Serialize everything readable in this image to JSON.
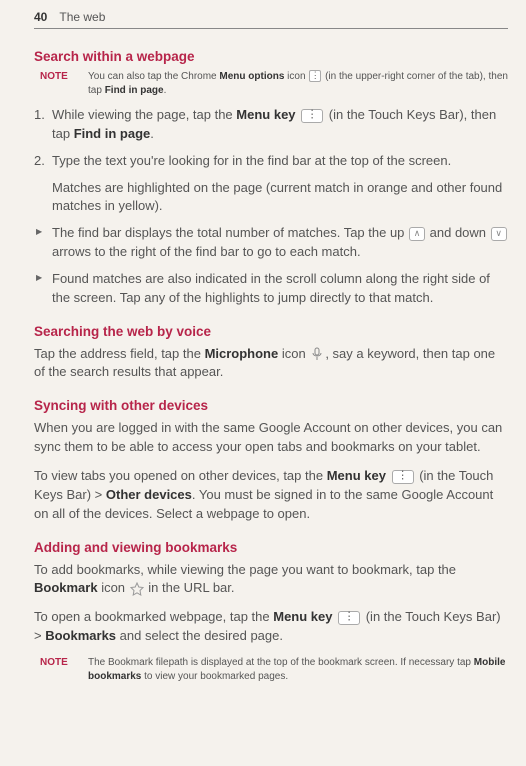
{
  "page_number": "40",
  "header_title": "The web",
  "sections": {
    "search_within": {
      "heading": "Search within a webpage",
      "note_label": "NOTE",
      "note_pre": "You can also tap the Chrome ",
      "note_bold1": "Menu options",
      "note_mid": " icon ",
      "note_post": " (in the upper-right corner of the tab), then tap ",
      "note_bold2": "Find in page",
      "note_end": ".",
      "step1_a": "While viewing the page, tap the ",
      "step1_bold": "Menu key",
      "step1_b": " (in the Touch Keys Bar), then tap ",
      "step1_bold2": "Find in page",
      "step1_c": ".",
      "step2": "Type the text you're looking for in the find bar at the top of the screen.",
      "step2_sub": "Matches are highlighted on the page (current match in orange and other found matches in yellow).",
      "bullet1_a": "The find bar displays the total number of matches. Tap the up ",
      "bullet1_b": " and down ",
      "bullet1_c": " arrows to the right of the find bar to go to each match.",
      "bullet2": "Found matches are also indicated in the scroll column along the right side of the screen. Tap any of the highlights to jump directly to that match."
    },
    "voice": {
      "heading": "Searching the web by voice",
      "text_a": "Tap the address field, tap the ",
      "text_bold": "Microphone",
      "text_b": " icon ",
      "text_c": ", say a keyword, then tap one of the search results that appear."
    },
    "syncing": {
      "heading": "Syncing with other devices",
      "p1": "When you are logged in with the same Google Account on other devices, you can sync them to be able to access your open tabs and bookmarks on your tablet.",
      "p2_a": "To view tabs you opened on other devices, tap the ",
      "p2_bold1": "Menu key",
      "p2_b": " (in the Touch Keys Bar) > ",
      "p2_bold2": "Other devices",
      "p2_c": ". You must be signed in to the same Google Account on all of the devices. Select a webpage to open."
    },
    "bookmarks": {
      "heading": "Adding and viewing bookmarks",
      "p1_a": "To add bookmarks, while viewing the page you want to bookmark, tap the ",
      "p1_bold": "Bookmark",
      "p1_b": " icon ",
      "p1_c": " in the URL bar.",
      "p2_a": "To open a bookmarked webpage, tap the ",
      "p2_bold1": "Menu key",
      "p2_b": " (in the Touch Keys Bar) > ",
      "p2_bold2": "Bookmarks",
      "p2_c": " and select the desired page.",
      "note_label": "NOTE",
      "note_a": "The Bookmark filepath is displayed at the top of the bookmark screen. If necessary tap ",
      "note_bold": "Mobile bookmarks",
      "note_b": " to view your bookmarked pages."
    }
  }
}
